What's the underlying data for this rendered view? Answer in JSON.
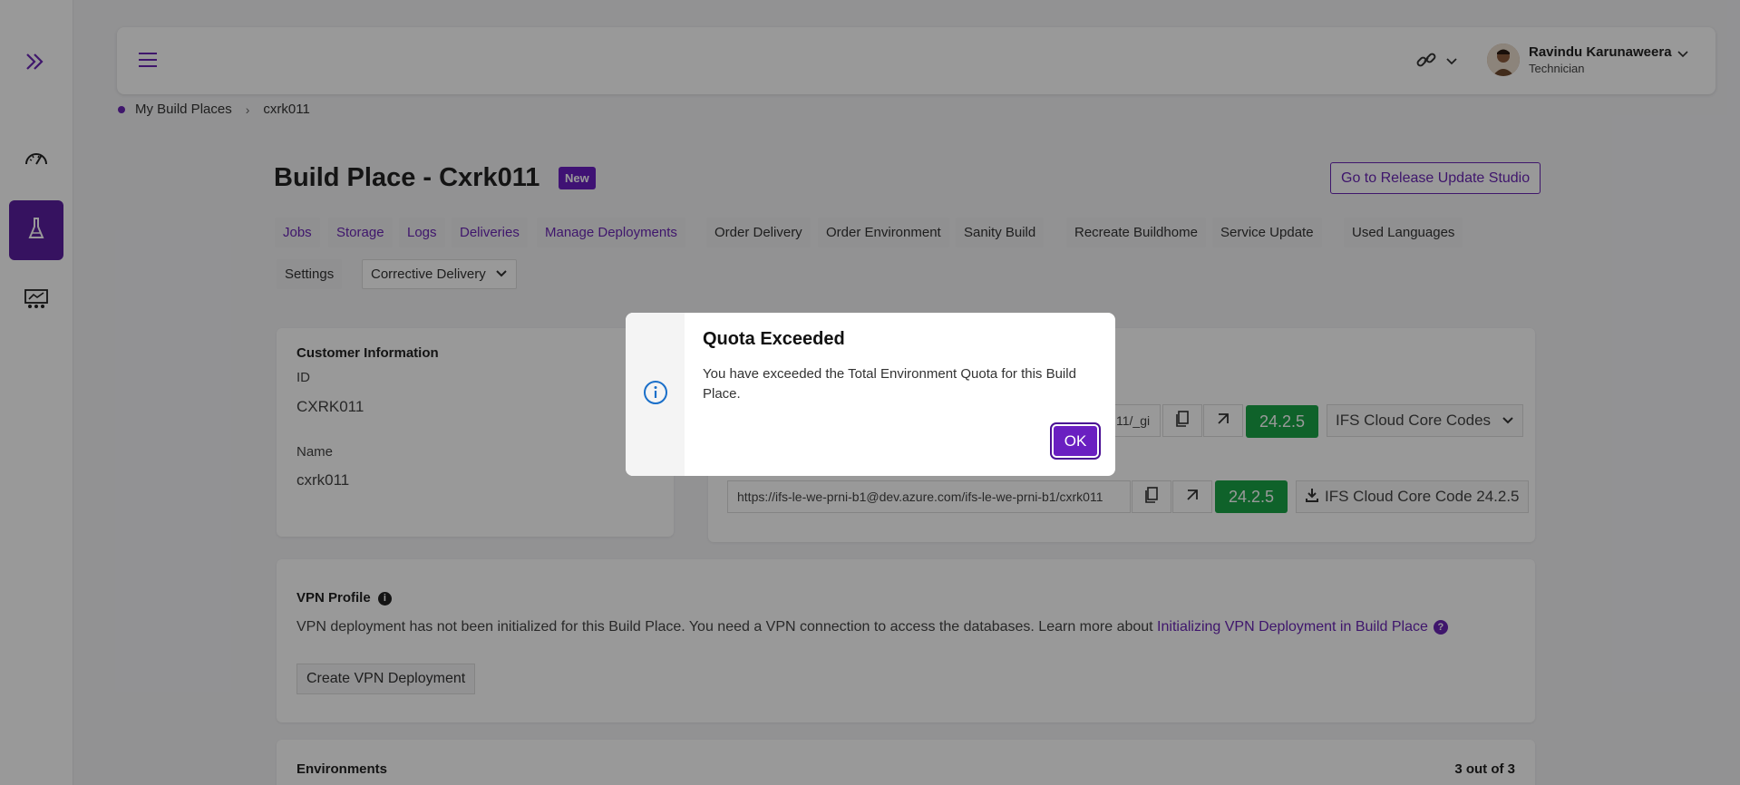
{
  "header": {
    "user_name": "Ravindu Karunaweera",
    "user_role": "Technician"
  },
  "breadcrumb": {
    "root": "My Build Places",
    "current": "cxrk011"
  },
  "page": {
    "title": "Build Place - Cxrk011",
    "badge": "New",
    "release_button": "Go to Release Update Studio"
  },
  "tabs": {
    "jobs": "Jobs",
    "storage": "Storage",
    "logs": "Logs",
    "deliveries": "Deliveries",
    "manage_deployments": "Manage Deployments",
    "order_delivery": "Order Delivery",
    "order_environment": "Order Environment",
    "sanity_build": "Sanity Build",
    "recreate_buildhome": "Recreate Buildhome",
    "service_update": "Service Update",
    "used_languages": "Used Languages",
    "settings": "Settings",
    "corrective_delivery": "Corrective Delivery"
  },
  "customer": {
    "heading": "Customer Information",
    "id_label": "ID",
    "id_value": "CXRK011",
    "name_label": "Name",
    "name_value": "cxrk011"
  },
  "repos": {
    "row1_url_tail": "11/_gi",
    "row1_version": "24.2.5",
    "row1_select": "IFS Cloud Core Codes",
    "row2_url": "https://ifs-le-we-prni-b1@dev.azure.com/ifs-le-we-prni-b1/cxrk011",
    "row2_version": "24.2.5",
    "row2_download": "IFS Cloud Core Code 24.2.5"
  },
  "vpn": {
    "heading": "VPN Profile",
    "text": "VPN deployment has not been initialized for this Build Place. You need a VPN connection to access the databases. Learn more about ",
    "link": "Initializing VPN Deployment in Build Place",
    "button": "Create VPN Deployment"
  },
  "environments": {
    "heading": "Environments",
    "count": "3 out of 3"
  },
  "modal": {
    "title": "Quota Exceeded",
    "message": "You have exceeded the Total Environment Quota for this Build Place.",
    "ok": "OK"
  },
  "colors": {
    "accent": "#6a26b5",
    "active_nav": "#5a1ea0",
    "version_green": "#1aa346"
  }
}
